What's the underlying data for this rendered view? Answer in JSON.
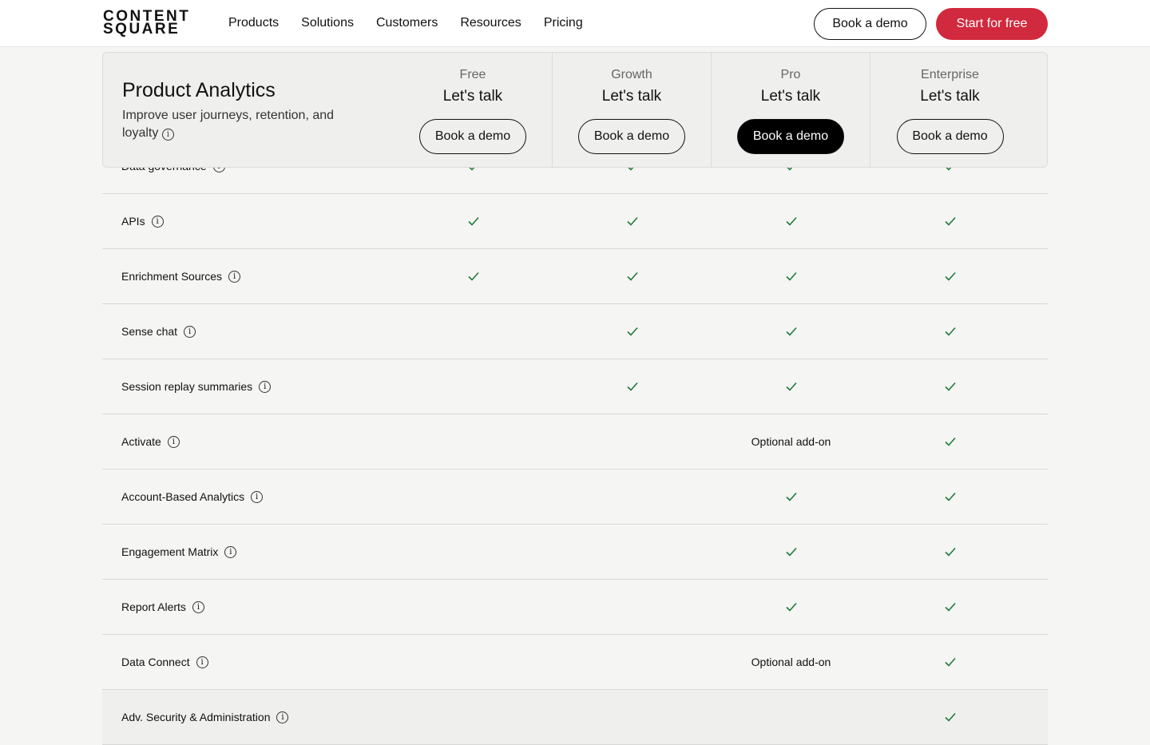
{
  "nav": {
    "logo_line1": "CONTENT",
    "logo_line2": "SQUARE",
    "items": [
      "Products",
      "Solutions",
      "Customers",
      "Resources",
      "Pricing"
    ],
    "book_demo": "Book a demo",
    "start_free": "Start for free"
  },
  "header": {
    "title": "Product Analytics",
    "subtitle": "Improve user journeys, retention, and loyalty",
    "plans": [
      {
        "name": "Free",
        "price": "Let's talk",
        "cta": "Book a demo"
      },
      {
        "name": "Growth",
        "price": "Let's talk",
        "cta": "Book a demo"
      },
      {
        "name": "Pro",
        "price": "Let's talk",
        "cta": "Book a demo"
      },
      {
        "name": "Enterprise",
        "price": "Let's talk",
        "cta": "Book a demo"
      }
    ]
  },
  "colors": {
    "check": "#1e7a3a",
    "accent": "#d1293d"
  },
  "rows": [
    {
      "label": "Data governance",
      "cells": [
        "check",
        "check",
        "check",
        "check"
      ]
    },
    {
      "label": "APIs",
      "cells": [
        "check",
        "check",
        "check",
        "check"
      ]
    },
    {
      "label": "Enrichment Sources",
      "cells": [
        "check",
        "check",
        "check",
        "check"
      ]
    },
    {
      "label": "Sense chat",
      "cells": [
        "",
        "check",
        "check",
        "check"
      ]
    },
    {
      "label": "Session replay summaries",
      "cells": [
        "",
        "check",
        "check",
        "check"
      ]
    },
    {
      "label": "Activate",
      "cells": [
        "",
        "",
        "Optional add-on",
        "check"
      ]
    },
    {
      "label": "Account-Based Analytics",
      "cells": [
        "",
        "",
        "check",
        "check"
      ]
    },
    {
      "label": "Engagement Matrix",
      "cells": [
        "",
        "",
        "check",
        "check"
      ]
    },
    {
      "label": "Report Alerts",
      "cells": [
        "",
        "",
        "check",
        "check"
      ]
    },
    {
      "label": "Data Connect",
      "cells": [
        "",
        "",
        "Optional add-on",
        "check"
      ]
    },
    {
      "label": "Adv. Security & Administration",
      "cells": [
        "",
        "",
        "",
        "check"
      ]
    }
  ]
}
